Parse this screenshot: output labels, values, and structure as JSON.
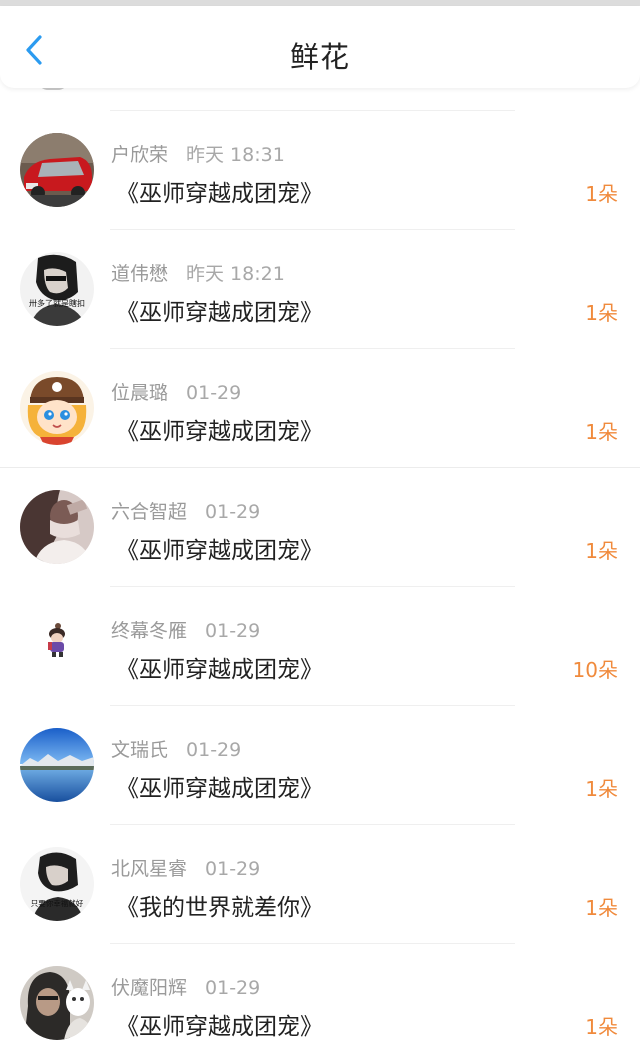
{
  "header": {
    "title": "鲜花",
    "back_icon": "chevron-left-icon",
    "accent_color": "#2b9bf0"
  },
  "count_color": "#f08a3c",
  "rows": [
    {
      "name": "户欣荣",
      "time": "昨天 18:31",
      "book": "《巫师穿越成团宠》",
      "count": "1朵"
    },
    {
      "name": "道伟懋",
      "time": "昨天 18:21",
      "book": "《巫师穿越成团宠》",
      "count": "1朵",
      "avatar_text": "卅多了就是瞎扣"
    },
    {
      "name": "位晨璐",
      "time": "01-29",
      "book": "《巫师穿越成团宠》",
      "count": "1朵"
    },
    {
      "name": "六合智超",
      "time": "01-29",
      "book": "《巫师穿越成团宠》",
      "count": "1朵"
    },
    {
      "name": "终幕冬雁",
      "time": "01-29",
      "book": "《巫师穿越成团宠》",
      "count": "10朵"
    },
    {
      "name": "文瑞氏",
      "time": "01-29",
      "book": "《巫师穿越成团宠》",
      "count": "1朵"
    },
    {
      "name": "北风星睿",
      "time": "01-29",
      "book": "《我的世界就差你》",
      "count": "1朵",
      "avatar_text": "只要你幸福就好"
    },
    {
      "name": "伏魔阳辉",
      "time": "01-29",
      "book": "《巫师穿越成团宠》",
      "count": "1朵"
    }
  ]
}
